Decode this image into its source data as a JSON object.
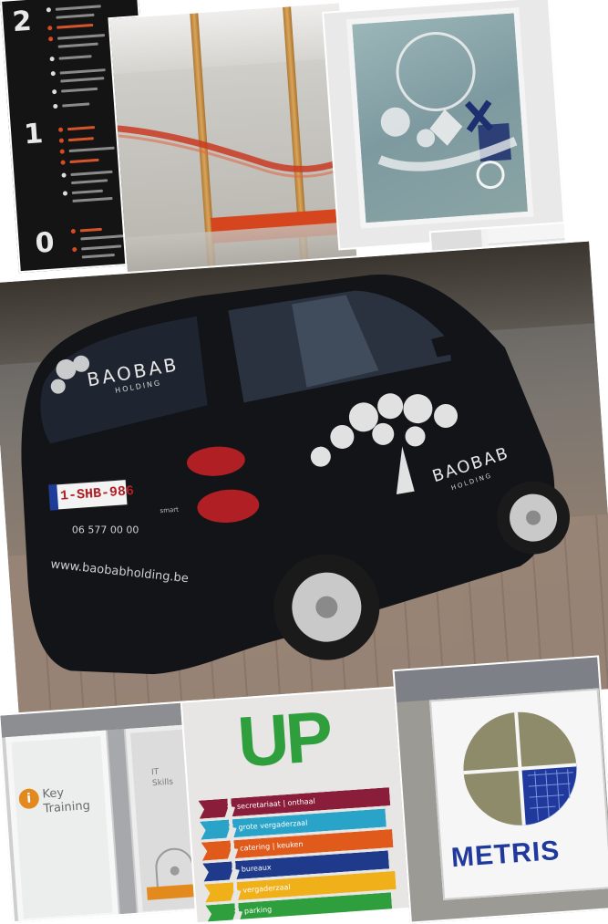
{
  "collage": {
    "directory": {
      "floors": [
        "2",
        "1",
        "0"
      ],
      "colors": {
        "panel": "#141414",
        "highlight": "#d84a20",
        "text": "#e9e9e9"
      }
    },
    "car": {
      "rear_window_brand": "BAOBAB",
      "rear_window_sub": "HOLDING",
      "side_brand": "BAOBAB",
      "side_sub": "HOLDING",
      "plate": "1-SHB-986",
      "phone": "06 577 00 00",
      "website": "www.baobabholding.be",
      "badge": "smart",
      "body_color": "#121418"
    },
    "keytraining": {
      "brand_line1": "Key",
      "brand_line2": "Training",
      "logo_letter": "i",
      "right_line1": "IT",
      "right_line2": "Skills",
      "accent": "#e38a1e"
    },
    "up": {
      "logo": "UP",
      "logo_color": "#2f9e3c",
      "arrows": [
        {
          "label": "secretariaat | onthaal",
          "color": "#8a1e3a"
        },
        {
          "label": "grote vergaderzaal",
          "color": "#2aa3c9"
        },
        {
          "label": "catering | keuken",
          "color": "#e05a1c"
        },
        {
          "label": "bureaux",
          "color": "#1f3a8a"
        },
        {
          "label": "vergaderzaal",
          "color": "#f0b01a"
        },
        {
          "label": "parking",
          "color": "#2f9e3c"
        }
      ]
    },
    "metris": {
      "wordmark": "METRIS",
      "wordmark_color": "#1f3a9c"
    },
    "window_logo": {
      "color": "#1d2f6e"
    },
    "sign_strip": {
      "mark": "KX",
      "color": "#c6282d"
    }
  }
}
